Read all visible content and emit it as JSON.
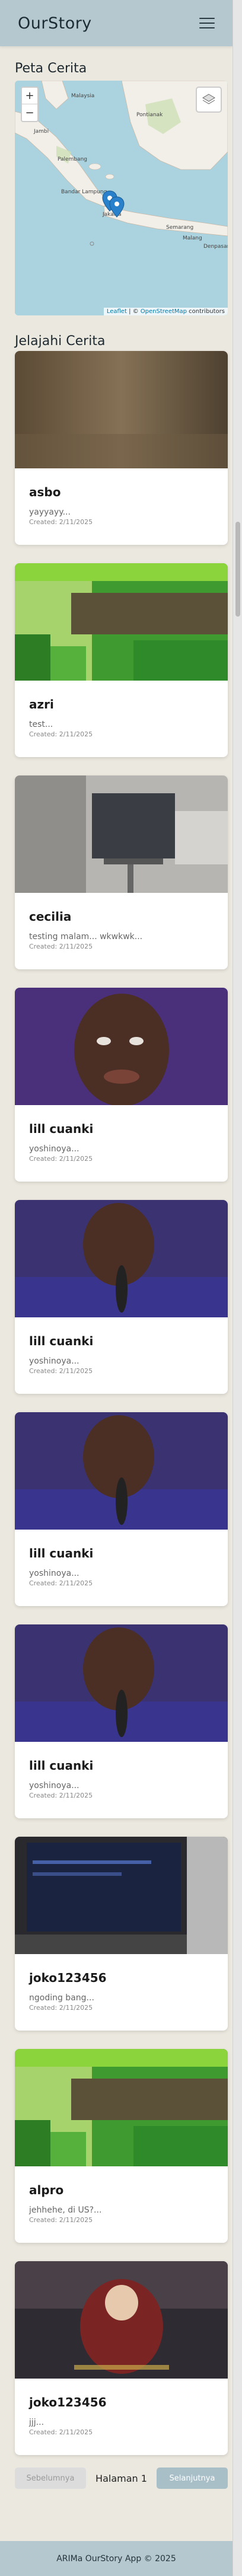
{
  "app": {
    "brand": "OurStory"
  },
  "map_section": {
    "title": "Peta Cerita",
    "zoom_in": "+",
    "zoom_out": "−",
    "attribution_leaflet": "Leaflet",
    "attribution_sep": " | © ",
    "attribution_osm": "OpenStreetMap",
    "attribution_tail": " contributors",
    "place_labels": [
      "Malaysia",
      "Pontianak",
      "Bandar Lampung",
      "Jakarta",
      "Semarang",
      "Malang",
      "Denpasar",
      "Palembang",
      "Jambi"
    ]
  },
  "stories_section": {
    "title": "Jelajahi Cerita",
    "stories": [
      {
        "name": "asbo",
        "desc": "yayyayy...",
        "date": "Created: 2/11/2025"
      },
      {
        "name": "azri",
        "desc": "test...",
        "date": "Created: 2/11/2025"
      },
      {
        "name": "cecilia",
        "desc": "testing malam... wkwkwk...",
        "date": "Created: 2/11/2025"
      },
      {
        "name": "lill cuanki",
        "desc": "yoshinoya...",
        "date": "Created: 2/11/2025"
      },
      {
        "name": "lill cuanki",
        "desc": "yoshinoya...",
        "date": "Created: 2/11/2025"
      },
      {
        "name": "lill cuanki",
        "desc": "yoshinoya...",
        "date": "Created: 2/11/2025"
      },
      {
        "name": "lill cuanki",
        "desc": "yoshinoya...",
        "date": "Created: 2/11/2025"
      },
      {
        "name": "joko123456",
        "desc": "ngoding bang...",
        "date": "Created: 2/11/2025"
      },
      {
        "name": "alpro",
        "desc": "jehhehe, di US?...",
        "date": "Created: 2/11/2025"
      },
      {
        "name": "joko123456",
        "desc": "jjj...",
        "date": "Created: 2/11/2025"
      }
    ]
  },
  "pagination": {
    "prev_label": "Sebelumnya",
    "page_info": "Halaman 1",
    "next_label": "Selanjutnya"
  },
  "footer": {
    "text": "ARIMa OurStory App © 2025"
  },
  "colors": {
    "header": "#b5c8cf",
    "background": "#ebe8df",
    "accent": "#a9bfc8"
  }
}
